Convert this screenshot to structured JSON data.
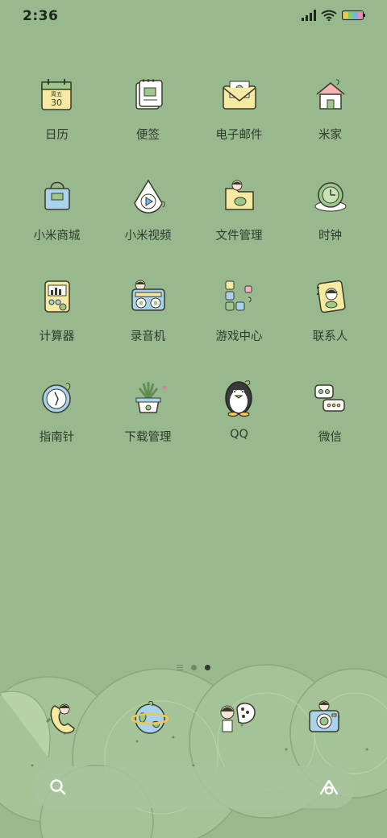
{
  "status_bar": {
    "time": "2:36",
    "icons": [
      "signal-icon",
      "wifi-icon",
      "battery-icon"
    ],
    "battery_colors": [
      "#f2c84b",
      "#7ecf6b",
      "#6fb7e8",
      "#f08ab0"
    ]
  },
  "apps": [
    {
      "label": "日历",
      "icon": "calendar-icon",
      "date_weekday": "周五",
      "date_day": "30"
    },
    {
      "label": "便签",
      "icon": "notes-icon"
    },
    {
      "label": "电子邮件",
      "icon": "email-icon"
    },
    {
      "label": "米家",
      "icon": "home-icon"
    },
    {
      "label": "小米商城",
      "icon": "shopping-bag-icon"
    },
    {
      "label": "小米视频",
      "icon": "video-icon"
    },
    {
      "label": "文件管理",
      "icon": "folder-icon"
    },
    {
      "label": "时钟",
      "icon": "clock-icon"
    },
    {
      "label": "计算器",
      "icon": "calculator-icon"
    },
    {
      "label": "录音机",
      "icon": "recorder-icon"
    },
    {
      "label": "游戏中心",
      "icon": "game-blocks-icon"
    },
    {
      "label": "联系人",
      "icon": "contacts-icon"
    },
    {
      "label": "指南针",
      "icon": "compass-icon"
    },
    {
      "label": "下载管理",
      "icon": "plant-download-icon"
    },
    {
      "label": "QQ",
      "icon": "penguin-icon"
    },
    {
      "label": "微信",
      "icon": "chat-bubbles-icon"
    }
  ],
  "page_indicator": {
    "pages": 3,
    "active": 2
  },
  "dock": [
    {
      "icon": "phone-icon"
    },
    {
      "icon": "browser-globe-icon"
    },
    {
      "icon": "messages-icon"
    },
    {
      "icon": "camera-icon"
    }
  ],
  "search_bar": {
    "left_icon": "search-icon",
    "right_icon": "assistant-icon"
  },
  "colors": {
    "background": "#98b98d",
    "kiwi_fill": "#a7c59a",
    "accent_yellow": "#f6eaa3",
    "accent_blue": "#a9d2ec"
  }
}
